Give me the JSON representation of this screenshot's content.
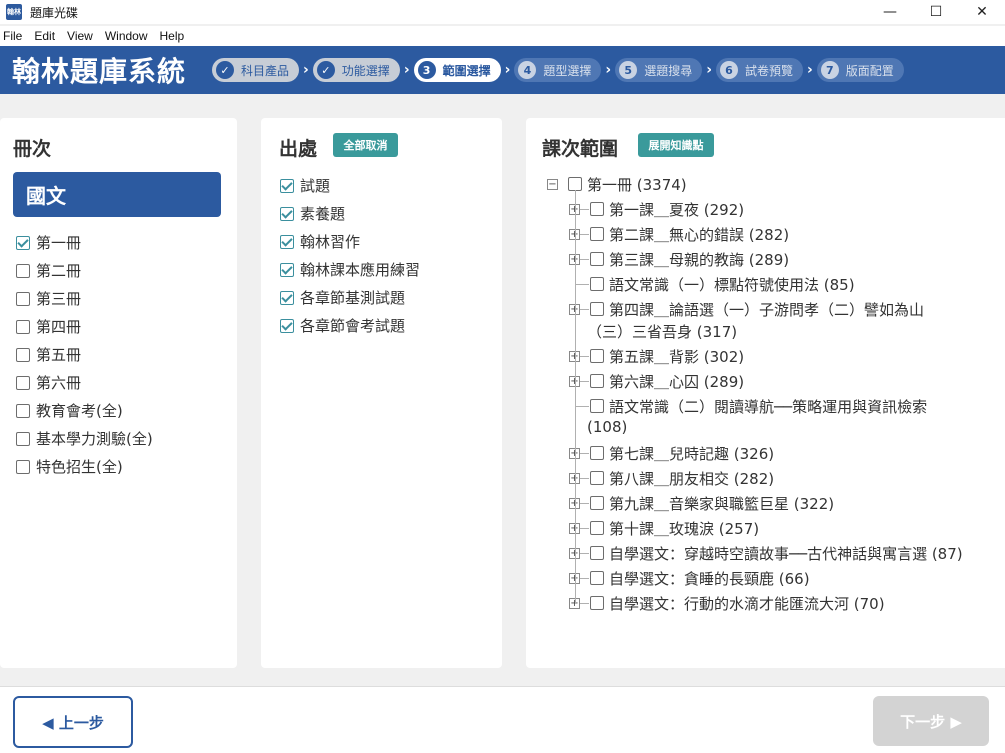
{
  "window": {
    "title": "題庫光碟",
    "icon_text": "翰林",
    "minimize": "—",
    "maximize": "☐",
    "close": "✕"
  },
  "menu": [
    "File",
    "Edit",
    "View",
    "Window",
    "Help"
  ],
  "brand": "翰林題庫系統",
  "steps": [
    {
      "num": "✓",
      "label": "科目產品",
      "state": "done"
    },
    {
      "num": "✓",
      "label": "功能選擇",
      "state": "done"
    },
    {
      "num": "3",
      "label": "範圍選擇",
      "state": "current"
    },
    {
      "num": "4",
      "label": "題型選擇",
      "state": "todo"
    },
    {
      "num": "5",
      "label": "選題搜尋",
      "state": "todo"
    },
    {
      "num": "6",
      "label": "試卷預覽",
      "state": "todo"
    },
    {
      "num": "7",
      "label": "版面配置",
      "state": "todo"
    }
  ],
  "volume_panel": {
    "title": "冊次",
    "subject": "國文",
    "items": [
      {
        "label": "第一冊",
        "checked": true
      },
      {
        "label": "第二冊",
        "checked": false
      },
      {
        "label": "第三冊",
        "checked": false
      },
      {
        "label": "第四冊",
        "checked": false
      },
      {
        "label": "第五冊",
        "checked": false
      },
      {
        "label": "第六冊",
        "checked": false
      },
      {
        "label": "教育會考(全)",
        "checked": false
      },
      {
        "label": "基本學力測驗(全)",
        "checked": false
      },
      {
        "label": "特色招生(全)",
        "checked": false
      }
    ]
  },
  "source_panel": {
    "title": "出處",
    "deselect_all": "全部取消",
    "items": [
      {
        "label": "試題",
        "checked": true
      },
      {
        "label": "素養題",
        "checked": true
      },
      {
        "label": "翰林習作",
        "checked": true
      },
      {
        "label": "翰林課本應用練習",
        "checked": true
      },
      {
        "label": "各章節基測試題",
        "checked": true
      },
      {
        "label": "各章節會考試題",
        "checked": true
      }
    ]
  },
  "lesson_panel": {
    "title": "課次範圍",
    "expand_btn": "展開知識點",
    "root": "第一冊 (3374)",
    "nodes": [
      {
        "lines": [
          "第一課＿夏夜 (292)"
        ],
        "expandable": true
      },
      {
        "lines": [
          "第二課＿無心的錯誤 (282)"
        ],
        "expandable": true
      },
      {
        "lines": [
          "第三課＿母親的教誨 (289)"
        ],
        "expandable": true
      },
      {
        "lines": [
          "語文常識（一）標點符號使用法 (85)"
        ],
        "expandable": false
      },
      {
        "lines": [
          "第四課＿論語選（一）子游問孝（二）譬如為山",
          "（三）三省吾身 (317)"
        ],
        "expandable": true
      },
      {
        "lines": [
          "第五課＿背影 (302)"
        ],
        "expandable": true
      },
      {
        "lines": [
          "第六課＿心囚 (289)"
        ],
        "expandable": true
      },
      {
        "lines": [
          "語文常識（二）閱讀導航──策略運用與資訊檢索",
          "(108)"
        ],
        "expandable": false
      },
      {
        "lines": [
          "第七課＿兒時記趣 (326)"
        ],
        "expandable": true
      },
      {
        "lines": [
          "第八課＿朋友相交 (282)"
        ],
        "expandable": true
      },
      {
        "lines": [
          "第九課＿音樂家與職籃巨星 (322)"
        ],
        "expandable": true
      },
      {
        "lines": [
          "第十課＿玫瑰淚 (257)"
        ],
        "expandable": true
      },
      {
        "lines": [
          "自學選文：穿越時空讀故事──古代神話與寓言選 (87)"
        ],
        "expandable": true
      },
      {
        "lines": [
          "自學選文：貪睡的長頸鹿 (66)"
        ],
        "expandable": true
      },
      {
        "lines": [
          "自學選文：行動的水滴才能匯流大河 (70)"
        ],
        "expandable": true
      }
    ]
  },
  "footer": {
    "prev": "◀ 上一步",
    "next": "下一步 ▶"
  }
}
